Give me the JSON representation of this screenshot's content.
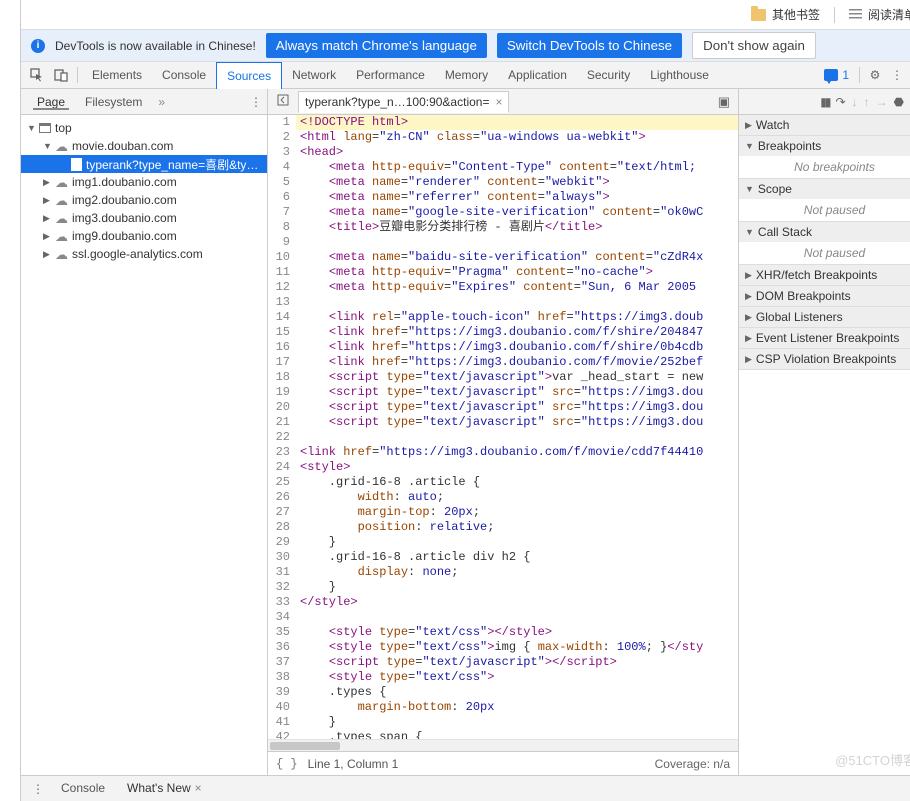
{
  "bookmarks": {
    "other": "其他书签",
    "reading": "阅读清单"
  },
  "banner": {
    "text": "DevTools is now available in Chinese!",
    "btn1": "Always match Chrome's language",
    "btn2": "Switch DevTools to Chinese",
    "btn3": "Don't show again"
  },
  "tabs": {
    "items": [
      "Elements",
      "Console",
      "Sources",
      "Network",
      "Performance",
      "Memory",
      "Application",
      "Security",
      "Lighthouse"
    ],
    "active": "Sources",
    "msg_count": "1"
  },
  "subtabs": {
    "page": "Page",
    "filesystem": "Filesystem"
  },
  "filetab": "typerank?type_n…100:90&action=",
  "tree": {
    "top": "top",
    "movie": "movie.douban.com",
    "selfile": "typerank?type_name=喜剧&ty…",
    "items": [
      "img1.doubanio.com",
      "img2.doubanio.com",
      "img3.doubanio.com",
      "img9.doubanio.com",
      "ssl.google-analytics.com"
    ]
  },
  "code": {
    "lines": [
      [
        "hl",
        "<span class='s-tag'>&lt;!DOCTYPE html&gt;</span>"
      ],
      [
        "",
        "<span class='s-tag'>&lt;html</span> <span class='s-attr'>lang</span>=<span class='s-str'>\"zh-CN\"</span> <span class='s-attr'>class</span>=<span class='s-str'>\"ua-windows ua-webkit\"</span><span class='s-tag'>&gt;</span>"
      ],
      [
        "",
        "<span class='s-tag'>&lt;head&gt;</span>"
      ],
      [
        "",
        "    <span class='s-tag'>&lt;meta</span> <span class='s-attr'>http-equiv</span>=<span class='s-str'>\"Content-Type\"</span> <span class='s-attr'>content</span>=<span class='s-str'>\"text/html;</span>"
      ],
      [
        "",
        "    <span class='s-tag'>&lt;meta</span> <span class='s-attr'>name</span>=<span class='s-str'>\"renderer\"</span> <span class='s-attr'>content</span>=<span class='s-str'>\"webkit\"</span><span class='s-tag'>&gt;</span>"
      ],
      [
        "",
        "    <span class='s-tag'>&lt;meta</span> <span class='s-attr'>name</span>=<span class='s-str'>\"referrer\"</span> <span class='s-attr'>content</span>=<span class='s-str'>\"always\"</span><span class='s-tag'>&gt;</span>"
      ],
      [
        "",
        "    <span class='s-tag'>&lt;meta</span> <span class='s-attr'>name</span>=<span class='s-str'>\"google-site-verification\"</span> <span class='s-attr'>content</span>=<span class='s-str'>\"ok0wC</span>"
      ],
      [
        "",
        "    <span class='s-tag'>&lt;title&gt;</span>豆瓣电影分类排行榜 - 喜剧片<span class='s-tag'>&lt;/title&gt;</span>"
      ],
      [
        "",
        ""
      ],
      [
        "",
        "    <span class='s-tag'>&lt;meta</span> <span class='s-attr'>name</span>=<span class='s-str'>\"baidu-site-verification\"</span> <span class='s-attr'>content</span>=<span class='s-str'>\"cZdR4x</span>"
      ],
      [
        "",
        "    <span class='s-tag'>&lt;meta</span> <span class='s-attr'>http-equiv</span>=<span class='s-str'>\"Pragma\"</span> <span class='s-attr'>content</span>=<span class='s-str'>\"no-cache\"</span><span class='s-tag'>&gt;</span>"
      ],
      [
        "",
        "    <span class='s-tag'>&lt;meta</span> <span class='s-attr'>http-equiv</span>=<span class='s-str'>\"Expires\"</span> <span class='s-attr'>content</span>=<span class='s-str'>\"Sun, 6 Mar 2005</span>"
      ],
      [
        "",
        ""
      ],
      [
        "",
        "    <span class='s-tag'>&lt;link</span> <span class='s-attr'>rel</span>=<span class='s-str'>\"apple-touch-icon\"</span> <span class='s-attr'>href</span>=<span class='s-str'>\"https://img3.doub</span>"
      ],
      [
        "",
        "    <span class='s-tag'>&lt;link</span> <span class='s-attr'>href</span>=<span class='s-str'>\"https://img3.doubanio.com/f/shire/204847</span>"
      ],
      [
        "",
        "    <span class='s-tag'>&lt;link</span> <span class='s-attr'>href</span>=<span class='s-str'>\"https://img3.doubanio.com/f/shire/0b4cdb</span>"
      ],
      [
        "",
        "    <span class='s-tag'>&lt;link</span> <span class='s-attr'>href</span>=<span class='s-str'>\"https://img3.doubanio.com/f/movie/252bef</span>"
      ],
      [
        "",
        "    <span class='s-tag'>&lt;script</span> <span class='s-attr'>type</span>=<span class='s-str'>\"text/javascript\"</span><span class='s-tag'>&gt;</span>var _head_start = new"
      ],
      [
        "",
        "    <span class='s-tag'>&lt;script</span> <span class='s-attr'>type</span>=<span class='s-str'>\"text/javascript\"</span> <span class='s-attr'>src</span>=<span class='s-str'>\"https://img3.dou</span>"
      ],
      [
        "",
        "    <span class='s-tag'>&lt;script</span> <span class='s-attr'>type</span>=<span class='s-str'>\"text/javascript\"</span> <span class='s-attr'>src</span>=<span class='s-str'>\"https://img3.dou</span>"
      ],
      [
        "",
        "    <span class='s-tag'>&lt;script</span> <span class='s-attr'>type</span>=<span class='s-str'>\"text/javascript\"</span> <span class='s-attr'>src</span>=<span class='s-str'>\"https://img3.dou</span>"
      ],
      [
        "",
        ""
      ],
      [
        "",
        "<span class='s-tag'>&lt;link</span> <span class='s-attr'>href</span>=<span class='s-str'>\"https://img3.doubanio.com/f/movie/cdd7f44410</span>"
      ],
      [
        "",
        "<span class='s-tag'>&lt;style&gt;</span>"
      ],
      [
        "",
        "    .grid-16-8 .article {"
      ],
      [
        "",
        "        <span class='s-prop'>width</span>: <span class='s-val'>auto</span>;"
      ],
      [
        "",
        "        <span class='s-prop'>margin-top</span>: <span class='s-num'>20px</span>;"
      ],
      [
        "",
        "        <span class='s-prop'>position</span>: <span class='s-val'>relative</span>;"
      ],
      [
        "",
        "    }"
      ],
      [
        "",
        "    .grid-16-8 .article div h2 {"
      ],
      [
        "",
        "        <span class='s-prop'>display</span>: <span class='s-val'>none</span>;"
      ],
      [
        "",
        "    }"
      ],
      [
        "",
        "<span class='s-tag'>&lt;/style&gt;</span>"
      ],
      [
        "",
        ""
      ],
      [
        "",
        "    <span class='s-tag'>&lt;style</span> <span class='s-attr'>type</span>=<span class='s-str'>\"text/css\"</span><span class='s-tag'>&gt;&lt;/style&gt;</span>"
      ],
      [
        "",
        "    <span class='s-tag'>&lt;style</span> <span class='s-attr'>type</span>=<span class='s-str'>\"text/css\"</span><span class='s-tag'>&gt;</span>img { <span class='s-prop'>max-width</span>: <span class='s-num'>100%</span>; }<span class='s-tag'>&lt;/sty</span>"
      ],
      [
        "",
        "    <span class='s-tag'>&lt;script</span> <span class='s-attr'>type</span>=<span class='s-str'>\"text/javascript\"</span><span class='s-tag'>&gt;&lt;/script&gt;</span>"
      ],
      [
        "",
        "    <span class='s-tag'>&lt;style</span> <span class='s-attr'>type</span>=<span class='s-str'>\"text/css\"</span><span class='s-tag'>&gt;</span>"
      ],
      [
        "",
        "    .types {"
      ],
      [
        "",
        "        <span class='s-prop'>margin-bottom</span>: <span class='s-num'>20px</span>"
      ],
      [
        "",
        "    }"
      ],
      [
        "",
        "    .types span {"
      ],
      [
        "",
        ""
      ]
    ]
  },
  "footer": {
    "pos": "Line 1, Column 1",
    "coverage": "Coverage: n/a"
  },
  "debugger": {
    "sections": [
      {
        "label": "Watch",
        "open": false
      },
      {
        "label": "Breakpoints",
        "open": true,
        "placeholder": "No breakpoints"
      },
      {
        "label": "Scope",
        "open": true,
        "placeholder": "Not paused"
      },
      {
        "label": "Call Stack",
        "open": true,
        "placeholder": "Not paused"
      },
      {
        "label": "XHR/fetch Breakpoints",
        "open": false
      },
      {
        "label": "DOM Breakpoints",
        "open": false
      },
      {
        "label": "Global Listeners",
        "open": false
      },
      {
        "label": "Event Listener Breakpoints",
        "open": false
      },
      {
        "label": "CSP Violation Breakpoints",
        "open": false
      }
    ]
  },
  "drawer": {
    "console": "Console",
    "whatsnew": "What's New"
  },
  "watermark": "@51CTO博客"
}
